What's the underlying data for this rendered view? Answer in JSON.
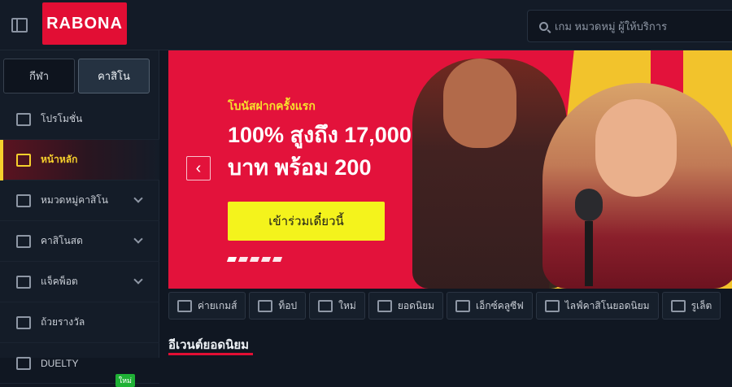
{
  "topbar": {
    "logo_text": "RABONA",
    "search_placeholder": "เกม หมวดหมู่ ผู้ให้บริการ"
  },
  "sidebar": {
    "tabs": [
      {
        "label": "กีฬา",
        "active": false
      },
      {
        "label": "คาสิโน",
        "active": true
      }
    ],
    "items": [
      {
        "label": "โปรโมชั่น",
        "icon": "gift-icon",
        "chevron": false,
        "active": false
      },
      {
        "label": "หน้าหลัก",
        "icon": "home-icon",
        "chevron": false,
        "active": true
      },
      {
        "label": "หมวดหมู่คาสิโน",
        "icon": "categories-icon",
        "chevron": true,
        "active": false
      },
      {
        "label": "คาสิโนสด",
        "icon": "live-cards-icon",
        "chevron": true,
        "active": false
      },
      {
        "label": "แจ็คพ็อต",
        "icon": "jackpot-icon",
        "chevron": true,
        "active": false
      },
      {
        "label": "ถ้วยรางวัล",
        "icon": "trophy-icon",
        "chevron": false,
        "active": false
      },
      {
        "label": "DUELTY",
        "icon": "duel-icon",
        "chevron": false,
        "active": false,
        "badge": "ใหม่"
      }
    ]
  },
  "hero": {
    "kicker": "โบนัสฝากครั้งแรก",
    "title": "100% สูงถึง 17,000 บาท พร้อม 200",
    "cta_label": "เข้าร่วมเดี๋ยวนี้",
    "prev_label": "‹",
    "slide_count": 5,
    "active_slide": 1
  },
  "categories": [
    {
      "label": "ค่ายเกมส์",
      "icon": "folder-icon"
    },
    {
      "label": "ท็อป",
      "icon": "crown-icon"
    },
    {
      "label": "ใหม่",
      "icon": "star-icon"
    },
    {
      "label": "ยอดนิยม",
      "icon": "flame-icon"
    },
    {
      "label": "เอ็กซ์คลูซีฟ",
      "icon": "gem-icon"
    },
    {
      "label": "ไลฟ์คาสิโนยอดนิยม",
      "icon": "crown-live-icon"
    },
    {
      "label": "รูเล็ต",
      "icon": "roulette-icon"
    }
  ],
  "section": {
    "title": "อีเวนต์ยอดนิยม"
  },
  "colors": {
    "brand": "#e20e34",
    "accent": "#f6d02c",
    "cta": "#f4f31c"
  }
}
